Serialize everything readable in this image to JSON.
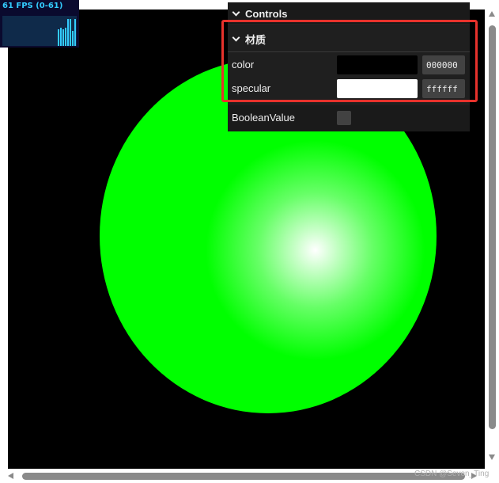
{
  "stats": {
    "fps_text": "61 FPS (0-61)",
    "graph_color": "#33ccff",
    "bar_heights": [
      0.55,
      0.6,
      0.55,
      0.6,
      0.9,
      0.9,
      0.5,
      0.9
    ]
  },
  "scene": {
    "background": "#000000",
    "sphere_color": "#00ff00",
    "highlight_color": "#ffffff"
  },
  "controls": {
    "title": "Controls",
    "folder": {
      "title": "材质",
      "rows": [
        {
          "label": "color",
          "swatch": "#000000",
          "hex": "000000"
        },
        {
          "label": "specular",
          "swatch": "#ffffff",
          "hex": "ffffff"
        }
      ]
    },
    "boolean": {
      "label": "BooleanValue",
      "checked": false
    }
  },
  "annotation": {
    "color": "#e8322c"
  },
  "watermark": "CSDN @Seven_Ting"
}
